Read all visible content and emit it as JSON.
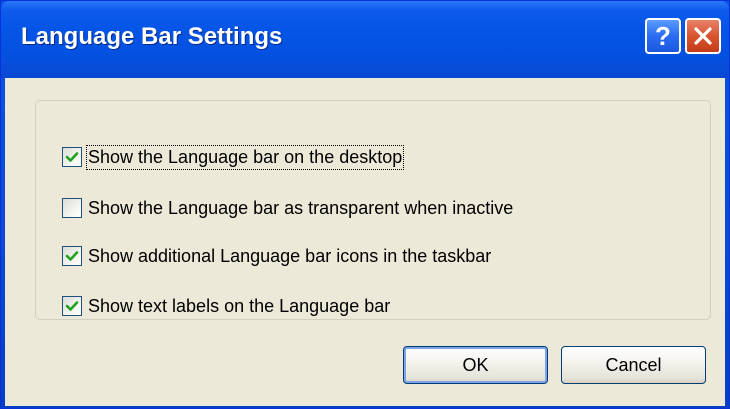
{
  "window": {
    "title": "Language Bar Settings",
    "help_glyph": "?",
    "close_glyph": "X"
  },
  "options": [
    {
      "label": "Show the Language bar on the desktop",
      "checked": true
    },
    {
      "label": "Show the Language bar as transparent when inactive",
      "checked": false
    },
    {
      "label": "Show additional Language bar icons in the taskbar",
      "checked": true
    },
    {
      "label": "Show text labels on the Language bar",
      "checked": true
    }
  ],
  "buttons": {
    "ok_label": "OK",
    "cancel_label": "Cancel"
  },
  "icons": {
    "help": "help-icon",
    "close": "close-icon",
    "check": "checkmark-icon"
  },
  "colors": {
    "titlebar": "#0454e6",
    "dialog_background": "#ece9d8",
    "check_mark": "#21a121",
    "close_button": "#d8542f"
  }
}
